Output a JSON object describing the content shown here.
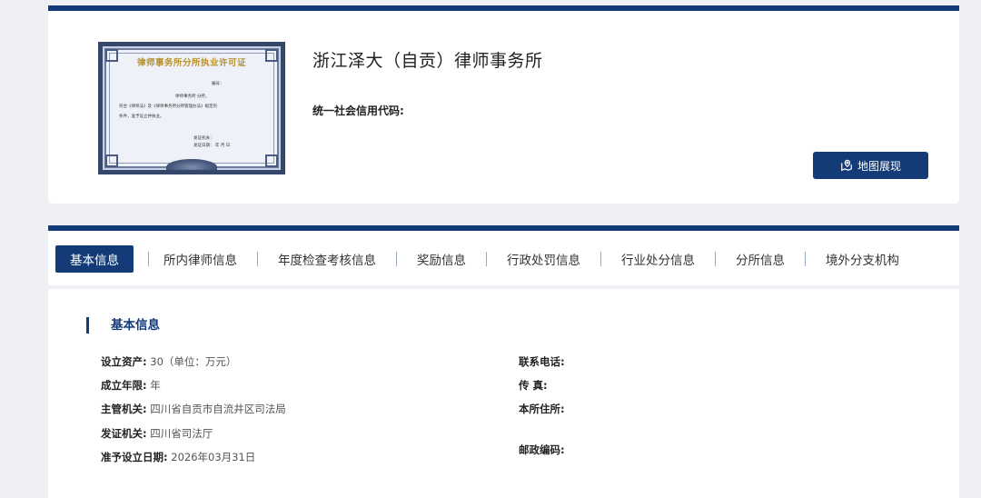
{
  "firm": {
    "name": "浙江泽大（自贡）律师事务所",
    "credit_code_label": "统一社会信用代码:",
    "credit_code_value": ""
  },
  "certificate": {
    "title": "律师事务所分所执业许可证",
    "line_no": "编号：",
    "line1": "律师事务所                    分所，",
    "line2": "符合《律师法》及《律师事务所分所管理办法》规定的",
    "line3": "条件，准予设立并执业。",
    "line4": "发证机关：",
    "line5": "发证日期：        年   月   日"
  },
  "map_button": {
    "label": "地图展现",
    "icon": "map-pin-icon"
  },
  "tabs": [
    {
      "label": "基本信息",
      "active": true
    },
    {
      "label": "所内律师信息"
    },
    {
      "label": "年度检查考核信息"
    },
    {
      "label": "奖励信息"
    },
    {
      "label": "行政处罚信息"
    },
    {
      "label": "行业处分信息"
    },
    {
      "label": "分所信息"
    },
    {
      "label": "境外分支机构"
    }
  ],
  "basic": {
    "title": "基本信息",
    "left": [
      {
        "label": "设立资产:",
        "value": "30（单位：万元）"
      },
      {
        "label": "成立年限:",
        "value": "年"
      },
      {
        "label": "主管机关:",
        "value": "四川省自贡市自流井区司法局"
      },
      {
        "label": "发证机关:",
        "value": "四川省司法厅"
      },
      {
        "label": "准予设立日期:",
        "value": "2026年03月31日"
      }
    ],
    "right": [
      {
        "label": "联系电话:",
        "value": ""
      },
      {
        "label": "传 真:",
        "value": ""
      },
      {
        "label": "本所住所:",
        "value": ""
      },
      {
        "label": "邮政编码:",
        "value": ""
      }
    ]
  },
  "colors": {
    "accent": "#123b78",
    "background": "#eef0f4"
  }
}
